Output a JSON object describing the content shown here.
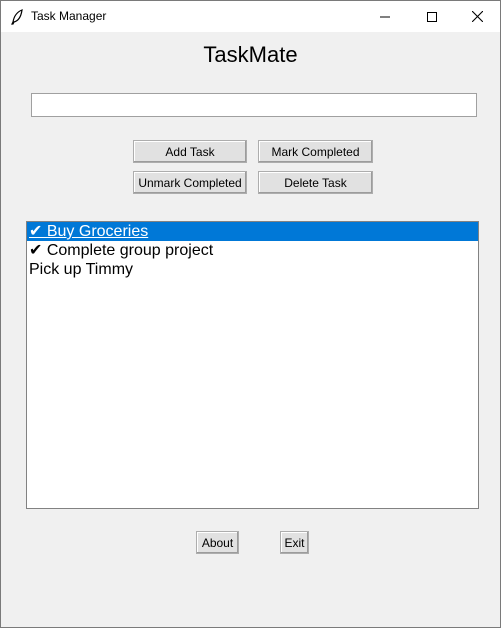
{
  "window": {
    "title": "Task Manager"
  },
  "app": {
    "heading": "TaskMate"
  },
  "input": {
    "value": "",
    "placeholder": ""
  },
  "buttons": {
    "add": "Add Task",
    "mark": "Mark Completed",
    "unmark": "Unmark Completed",
    "delete": "Delete Task",
    "about": "About",
    "exit": "Exit"
  },
  "tasks": [
    {
      "text": "✔ Buy Groceries",
      "completed": true,
      "selected": true
    },
    {
      "text": "✔ Complete group project",
      "completed": true,
      "selected": false
    },
    {
      "text": "Pick up Timmy",
      "completed": false,
      "selected": false
    }
  ],
  "colors": {
    "selection": "#0078d7",
    "background": "#f0f0f0"
  },
  "icons": {
    "app": "feather-icon",
    "minimize": "minimize-icon",
    "maximize": "maximize-icon",
    "close": "close-icon"
  }
}
